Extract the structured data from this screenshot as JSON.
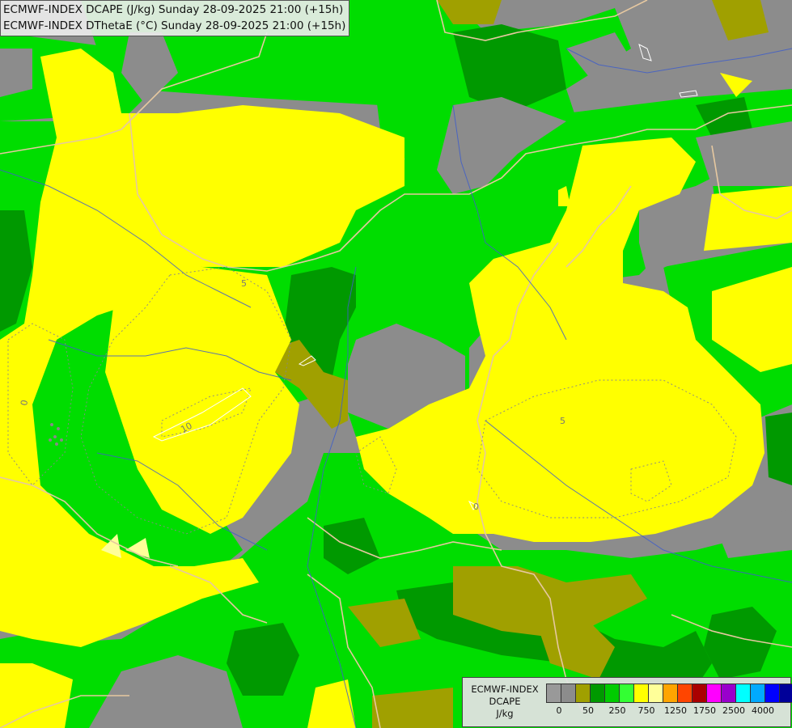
{
  "header": {
    "line1": "ECMWF-INDEX DCAPE (J/kg) Sunday 28-09-2025 21:00 (+15h)",
    "line2": "ECMWF-INDEX DThetaE (°C) Sunday 28-09-2025 21:00 (+15h)"
  },
  "legend": {
    "title_lines": [
      "ECMWF-INDEX",
      "DCAPE",
      "J/kg"
    ],
    "colors": [
      "#999999",
      "#8c8c8c",
      "#a0a000",
      "#009900",
      "#00cc00",
      "#33ff33",
      "#ffff00",
      "#ffff99",
      "#ffa500",
      "#ff4500",
      "#aa0000",
      "#ff00ff",
      "#9900cc",
      "#00ffff",
      "#00aaff",
      "#0000ff",
      "#000099"
    ],
    "tick_labels": [
      "0",
      "50",
      "250",
      "750",
      "1250",
      "1750",
      "2500",
      "4000"
    ]
  },
  "contour_labels": {
    "a": "5",
    "b": "10",
    "c": "0",
    "d": "5",
    "e": "0"
  },
  "map_colors": {
    "gray": "#8c8c8c",
    "olive": "#a0a000",
    "dark_green": "#009900",
    "green": "#00dd00",
    "light_green": "#33ff33",
    "yellow": "#ffff00",
    "pale_yellow": "#ffff99"
  }
}
